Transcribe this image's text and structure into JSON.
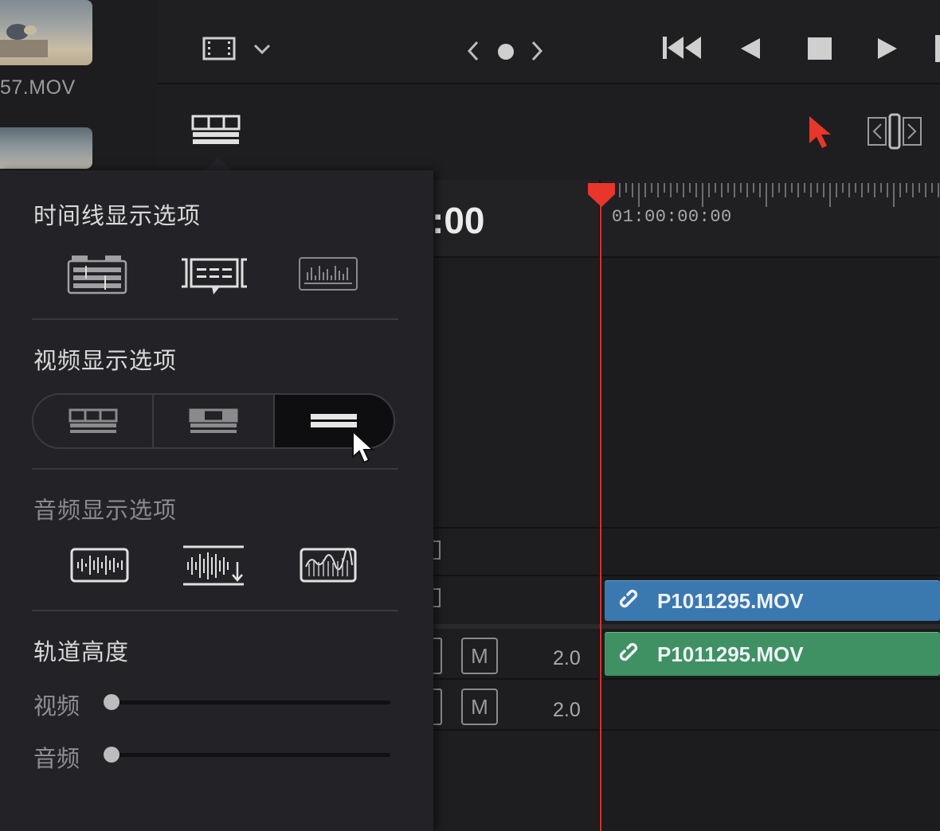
{
  "media_pool": {
    "clip1_label": "57.MOV"
  },
  "timeline": {
    "timecode_partial": ":00",
    "ruler_start": "01:00:00:00",
    "tracks": [
      {
        "clip_name": "P1011295.MOV",
        "color": "#3a78b0"
      },
      {
        "clip_name": "P1011295.MOV",
        "color": "#3f9163"
      }
    ],
    "audio_tracks": [
      {
        "mute_label": "M",
        "volume": "2.0"
      },
      {
        "mute_label": "M",
        "volume": "2.0"
      }
    ]
  },
  "popup": {
    "timeline_options_title": "时间线显示选项",
    "video_options_title": "视频显示选项",
    "audio_options_title": "音频显示选项",
    "track_height_title": "轨道高度",
    "video_label": "视频",
    "audio_label": "音频",
    "video_track_height": 0,
    "audio_track_height": 0,
    "selected_video_option": 3
  },
  "colors": {
    "accent_red": "#e8362b",
    "playhead": "#d8332b"
  },
  "icons": [
    "film-strip-icon",
    "chevron-down-icon",
    "prev-marker-icon",
    "marker-dot-icon",
    "next-marker-icon",
    "go-to-start-icon",
    "play-reverse-icon",
    "stop-icon",
    "play-icon",
    "timeline-view-options-icon",
    "selection-arrow-icon",
    "trim-edit-icon",
    "link-icon"
  ]
}
